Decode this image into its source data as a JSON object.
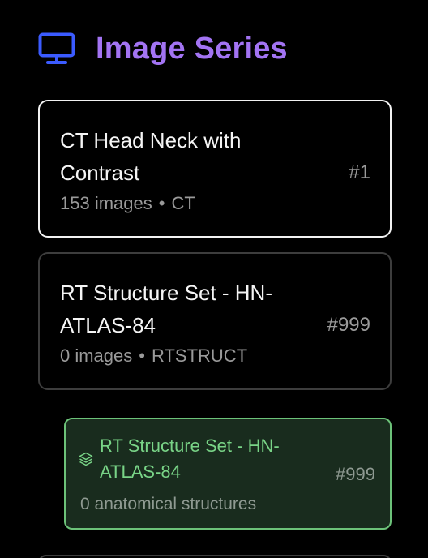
{
  "header": {
    "icon": "monitor-icon",
    "title": "Image Series",
    "accent_color": "#a374f3"
  },
  "series": [
    {
      "name": "CT Head Neck with Contrast",
      "number": "#1",
      "count": "153 images",
      "separator": "•",
      "modality": "CT",
      "selected": true
    },
    {
      "name": "RT Structure Set - HN-ATLAS-84",
      "number": "#999",
      "count": "0 images",
      "separator": "•",
      "modality": "RTSTRUCT",
      "selected": false
    }
  ],
  "structure_set": {
    "icon": "layers-icon",
    "name": "RT Structure Set - HN-ATLAS-84",
    "number": "#999",
    "count": "0 anatomical structures",
    "accent_color": "#6cc279"
  }
}
